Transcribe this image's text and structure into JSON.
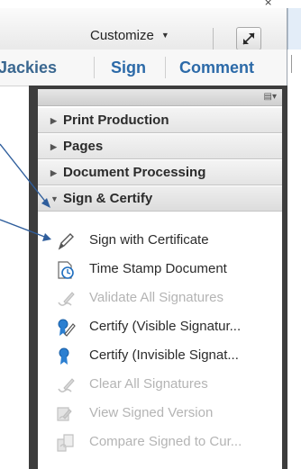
{
  "toolbar": {
    "customize_label": "Customize",
    "customize_caret": "▼"
  },
  "tabs": [
    {
      "label": "Jackies"
    },
    {
      "label": "Sign"
    },
    {
      "label": "Comment"
    }
  ],
  "panel": {
    "options_icon": "list-options-icon",
    "sections": [
      {
        "label": "Print Production",
        "expanded": false
      },
      {
        "label": "Pages",
        "expanded": false
      },
      {
        "label": "Document Processing",
        "expanded": false
      },
      {
        "label": "Sign & Certify",
        "expanded": true
      }
    ],
    "sign_certify_items": [
      {
        "label": "Sign with Certificate",
        "enabled": true,
        "icon": "pen-icon"
      },
      {
        "label": "Time Stamp Document",
        "enabled": true,
        "icon": "timestamp-icon"
      },
      {
        "label": "Validate All Signatures",
        "enabled": false,
        "icon": "validate-pen-icon"
      },
      {
        "label": "Certify (Visible Signatur...",
        "enabled": true,
        "icon": "certify-visible-icon"
      },
      {
        "label": "Certify (Invisible Signat...",
        "enabled": true,
        "icon": "certify-invisible-icon"
      },
      {
        "label": "Clear All Signatures",
        "enabled": false,
        "icon": "clear-signatures-icon"
      },
      {
        "label": "View Signed Version",
        "enabled": false,
        "icon": "view-signed-icon"
      },
      {
        "label": "Compare Signed to Cur...",
        "enabled": false,
        "icon": "compare-signed-icon"
      }
    ]
  },
  "colors": {
    "tab_text": "#2c6aa8",
    "callout_line": "#2f5e9c",
    "frame": "#3d3d3d",
    "disabled_text": "#b4b4b4"
  }
}
